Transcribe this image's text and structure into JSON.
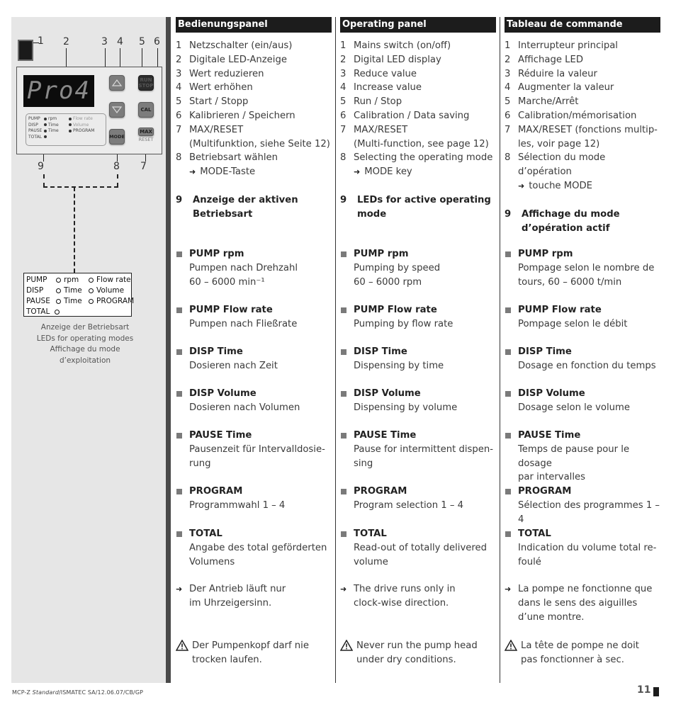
{
  "figure": {
    "callouts": [
      "1",
      "2",
      "3",
      "4",
      "5",
      "6",
      "7",
      "8",
      "9"
    ],
    "display_text": "Pro4",
    "buttons": {
      "up": "up-arrow",
      "down": "down-arrow",
      "run_stop_line1": "RUN",
      "run_stop_line2": "STOP",
      "cal": "CAL",
      "mode": "MODE",
      "max": "MAX",
      "reset": "RESET"
    },
    "mini_leds": [
      {
        "group": "PUMP",
        "left": "rpm",
        "right": "Flow rate"
      },
      {
        "group": "DISP",
        "left": "Time",
        "right": "Volume"
      },
      {
        "group": "PAUSE",
        "left": "Time",
        "right": "PROGRAM"
      },
      {
        "group": "TOTAL",
        "left": "",
        "right": ""
      }
    ],
    "legend": {
      "rows": [
        {
          "group": "PUMP",
          "left": "rpm",
          "right": "Flow rate"
        },
        {
          "group": "DISP",
          "left": "Time",
          "right": "Volume"
        },
        {
          "group": "PAUSE",
          "left": "Time",
          "right": "PROGRAM"
        },
        {
          "group": "TOTAL",
          "left": "",
          "right": ""
        }
      ]
    },
    "caption": [
      "Anzeige der Betriebsart",
      "LEDs for operating modes",
      "Affichage du mode",
      "d’exploitation"
    ]
  },
  "columns": [
    {
      "header": "Bedienungspanel",
      "items": [
        {
          "n": "1",
          "text": "Netzschalter (ein/aus)"
        },
        {
          "n": "2",
          "text": "Digitale LED-Anzeige"
        },
        {
          "n": "3",
          "text": "Wert reduzieren"
        },
        {
          "n": "4",
          "text": "Wert erhöhen"
        },
        {
          "n": "5",
          "text": "Start / Stopp"
        },
        {
          "n": "6",
          "text": "Kalibrieren / Speichern"
        },
        {
          "n": "7",
          "text": "MAX/RESET"
        },
        {
          "n": "",
          "text": "(Multifunktion, siehe Seite 12)"
        },
        {
          "n": "8",
          "text": "Betriebsart wählen"
        }
      ],
      "arrow_item": "MODE-Taste",
      "item9": {
        "n": "9",
        "line1": "Anzeige der aktiven",
        "line2": "Betriebsart"
      },
      "modes": [
        {
          "title": "PUMP rpm",
          "desc": [
            "Pumpen nach Drehzahl",
            "60 – 6000 min⁻¹"
          ]
        },
        {
          "title": "PUMP Flow rate",
          "desc": [
            "Pumpen nach Fließrate"
          ]
        },
        {
          "title": "DISP Time",
          "desc": [
            "Dosieren nach Zeit"
          ]
        },
        {
          "title": "DISP Volume",
          "desc": [
            "Dosieren nach Volumen"
          ]
        },
        {
          "title": "PAUSE Time",
          "desc": [
            "Pausenzeit für Intervalldosie-",
            "rung"
          ]
        },
        {
          "title": "PROGRAM",
          "desc": [
            "Programmwahl 1 – 4"
          ]
        },
        {
          "title": "TOTAL",
          "desc": [
            "Angabe des total geförderten",
            "Volumens"
          ]
        }
      ],
      "note": [
        "Der Antrieb läuft nur",
        "im Uhrzeigersinn."
      ],
      "warning": [
        "Der Pumpenkopf darf nie",
        "trocken laufen."
      ]
    },
    {
      "header": "Operating panel",
      "items": [
        {
          "n": "1",
          "text": "Mains switch (on/off)"
        },
        {
          "n": "2",
          "text": "Digital LED display"
        },
        {
          "n": "3",
          "text": "Reduce value"
        },
        {
          "n": "4",
          "text": "Increase value"
        },
        {
          "n": "5",
          "text": "Run / Stop"
        },
        {
          "n": "6",
          "text": "Calibration / Data saving"
        },
        {
          "n": "7",
          "text": "MAX/RESET"
        },
        {
          "n": "",
          "text": "(Multi-function, see page 12)"
        },
        {
          "n": "8",
          "text": "Selecting the operating mode"
        }
      ],
      "arrow_item": "MODE key",
      "item9": {
        "n": "9",
        "line1": "LEDs for active operating",
        "line2": "mode"
      },
      "modes": [
        {
          "title": "PUMP rpm",
          "desc": [
            "Pumping by speed",
            "60 – 6000 rpm"
          ]
        },
        {
          "title": "PUMP Flow rate",
          "desc": [
            "Pumping by flow rate"
          ]
        },
        {
          "title": "DISP Time",
          "desc": [
            "Dispensing by time"
          ]
        },
        {
          "title": "DISP Volume",
          "desc": [
            "Dispensing by volume"
          ]
        },
        {
          "title": "PAUSE Time",
          "desc": [
            "Pause for intermittent dispen-",
            "sing"
          ]
        },
        {
          "title": "PROGRAM",
          "desc": [
            "Program selection 1 – 4"
          ]
        },
        {
          "title": "TOTAL",
          "desc": [
            "Read-out of totally delivered",
            "volume"
          ]
        }
      ],
      "note": [
        "The drive runs only in",
        "clock-wise direction."
      ],
      "warning": [
        "Never run the pump head",
        "under dry conditions."
      ]
    },
    {
      "header": "Tableau de commande",
      "items": [
        {
          "n": "1",
          "text": "Interrupteur principal"
        },
        {
          "n": "2",
          "text": "Affichage LED"
        },
        {
          "n": "3",
          "text": "Réduire la valeur"
        },
        {
          "n": "4",
          "text": "Augmenter la valeur"
        },
        {
          "n": "5",
          "text": "Marche/Arrêt"
        },
        {
          "n": "6",
          "text": "Calibration/mémorisation"
        },
        {
          "n": "7",
          "text": "MAX/RESET  (fonctions multip-"
        },
        {
          "n": "",
          "text": "les, voir page 12)"
        },
        {
          "n": "8",
          "text": "Sélection du mode d’opération"
        }
      ],
      "arrow_item": "touche MODE",
      "item9": {
        "n": "9",
        "line1": "Affichage du mode",
        "line2": "d’opération actif"
      },
      "modes": [
        {
          "title": "PUMP rpm",
          "desc": [
            "Pompage selon le nombre de",
            "tours, 60 – 6000 t/min"
          ]
        },
        {
          "title": "PUMP Flow rate",
          "desc": [
            "Pompage selon le débit"
          ]
        },
        {
          "title": "DISP Time",
          "desc": [
            "Dosage en fonction du temps"
          ]
        },
        {
          "title": "DISP Volume",
          "desc": [
            "Dosage selon le volume"
          ]
        },
        {
          "title": "PAUSE Time",
          "desc": [
            "Temps de pause pour le dosage",
            "par intervalles"
          ]
        },
        {
          "title": "PROGRAM",
          "desc": [
            "Sélection des programmes 1 – 4"
          ]
        },
        {
          "title": "TOTAL",
          "desc": [
            "Indication du volume total re-",
            "foulé"
          ]
        }
      ],
      "note": [
        "La pompe ne fonctionne que",
        "dans le sens des aiguilles",
        "d’une montre."
      ],
      "warning": [
        "La tête de pompe ne doit",
        "pas fonctionner à sec."
      ]
    }
  ],
  "icons": {
    "bullet": "square-bullet-icon",
    "arrow": "right-arrow-icon",
    "warning": "warning-triangle-icon"
  },
  "footer": {
    "doc_prefix": "MCP-Z ",
    "doc_italic": "Standard",
    "doc_suffix": "/ISMATEC SA/12.06.07/CB/GP",
    "page_number": "11"
  }
}
